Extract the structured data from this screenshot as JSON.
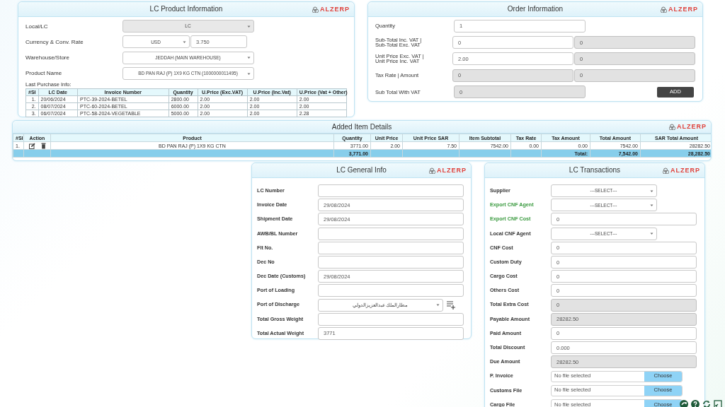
{
  "product_panel": {
    "title": "LC Product Information",
    "logo": "ALZERP",
    "fields": [
      {
        "label": "Local/LC",
        "controls": [
          {
            "kind": "select",
            "value": "LC",
            "disabled": true
          }
        ]
      },
      {
        "label": "Currency & Conv. Rate",
        "controls": [
          {
            "kind": "select",
            "value": "USD",
            "disabled": false
          },
          {
            "kind": "text",
            "value": "3.750",
            "readonly": false
          }
        ]
      },
      {
        "label": "Warehouse/Store",
        "controls": [
          {
            "kind": "select",
            "value": "JEDDAH (MAIN WAREHOUSE)",
            "disabled": false
          }
        ]
      },
      {
        "label": "Product Name",
        "controls": [
          {
            "kind": "select",
            "value": "BD PAN RAJ (P) 1X9 KG CTN (1000000011495)",
            "disabled": false
          }
        ]
      }
    ],
    "history_label": "Last Purchase Info:",
    "history": {
      "columns": [
        "#SI",
        "LC Date",
        "Invoice Number",
        "Quantity",
        "U.Price (Exc.VAT)",
        "U.Price (Inc.Vat)",
        "U.Price (Vat + Other)"
      ],
      "rows": [
        [
          "1.",
          "20/06/2024",
          "PTC-39-2024-BETEL",
          "2800.00",
          "2.00",
          "2.00",
          "2.00"
        ],
        [
          "2.",
          "08/07/2024",
          "PTC-60-2024-BETEL",
          "6000.00",
          "2.00",
          "2.00",
          "2.00"
        ],
        [
          "3.",
          "06/07/2024",
          "PTC-58-2024-VEGETABLE",
          "5000.00",
          "2.00",
          "2.00",
          "2.28"
        ]
      ]
    }
  },
  "order_panel": {
    "title": "Order Information",
    "logo": "ALZERP",
    "fields": [
      {
        "label": "Quantity",
        "controls": [
          {
            "kind": "text",
            "value": "1",
            "readonly": false
          }
        ]
      },
      {
        "label": "Sub-Total Inc. VAT |\nSub-Total Exc. VAT",
        "controls": [
          {
            "kind": "text",
            "value": "0",
            "readonly": false
          },
          {
            "kind": "text",
            "value": "0",
            "readonly": true
          }
        ]
      },
      {
        "label": "Unit Price Exc. VAT |\nUnit Price Inc. VAT",
        "controls": [
          {
            "kind": "text",
            "value": "2.00",
            "readonly": false
          },
          {
            "kind": "text",
            "value": "0",
            "readonly": true
          }
        ]
      },
      {
        "label": "Tax Rate | Amount",
        "controls": [
          {
            "kind": "text",
            "value": "0",
            "readonly": true
          },
          {
            "kind": "text",
            "value": "0",
            "readonly": true
          }
        ]
      },
      {
        "label": "Sub Total With VAT",
        "controls": [
          {
            "kind": "text",
            "value": "0",
            "readonly": true
          }
        ]
      }
    ],
    "button": "ADD"
  },
  "items_panel": {
    "title": "Added Item Details",
    "logo": "ALZERP",
    "columns": [
      "#SI",
      "Action",
      "Product",
      "Quantity",
      "Unit Price",
      "Unit Price SAR",
      "Item Subtotal",
      "Tax Rate",
      "Tax Amount",
      "Total Amount",
      "SAR Total Amount"
    ],
    "rows": [
      {
        "si": "1.",
        "product": "BD PAN RAJ (P) 1X9 KG CTN",
        "quantity": "3771.00",
        "unit_price": "2.00",
        "unit_price_sar": "7.50",
        "item_subtotal": "7542.00",
        "tax_rate": "0.00",
        "tax_amount": "0.00",
        "total_amount": "7542.00",
        "sar_total_amount": "28282.50"
      }
    ],
    "totals": {
      "quantity": "3,771.00",
      "label": "Total:",
      "total_amount": "7,542.00",
      "sar_total_amount": "28,282.50"
    }
  },
  "general_panel": {
    "title": "LC General Info",
    "logo": "ALZERP",
    "fields": [
      {
        "label": "LC Number",
        "controls": [
          {
            "kind": "text",
            "readonly": false
          }
        ]
      },
      {
        "label": "Invoice Date",
        "controls": [
          {
            "kind": "text",
            "value": "29/08/2024",
            "readonly": false
          }
        ]
      },
      {
        "label": "Shipment Date",
        "controls": [
          {
            "kind": "text",
            "value": "29/08/2024",
            "readonly": false
          }
        ]
      },
      {
        "label": "AWB/BL Number",
        "controls": [
          {
            "kind": "text",
            "readonly": false
          }
        ]
      },
      {
        "label": "Flt No.",
        "controls": [
          {
            "kind": "text",
            "readonly": false
          }
        ]
      },
      {
        "label": "Dec No",
        "controls": [
          {
            "kind": "text",
            "readonly": false
          }
        ]
      },
      {
        "label": "Dec Date (Customs)",
        "controls": [
          {
            "kind": "text",
            "value": "29/08/2024",
            "readonly": false
          }
        ]
      },
      {
        "label": "Port of Loading",
        "controls": [
          {
            "kind": "text",
            "readonly": false
          }
        ]
      },
      {
        "label": "Port of Discharge",
        "controls": [
          {
            "kind": "select",
            "value": "مطارالملك عبدالعزيزالدولي",
            "disabled": false
          },
          {
            "kind": "add"
          }
        ]
      },
      {
        "label": "Total Gross Weight",
        "controls": [
          {
            "kind": "text",
            "readonly": false
          }
        ]
      },
      {
        "label": "Total Actual Weight",
        "controls": [
          {
            "kind": "text",
            "value": "3771",
            "readonly": false
          }
        ]
      }
    ]
  },
  "transactions_panel": {
    "title": "LC Transactions",
    "logo": "ALZERP",
    "fields": [
      {
        "label": "Supplier",
        "color": "#333333",
        "controls": [
          {
            "kind": "select",
            "value": "---SELECT---",
            "disabled": false
          }
        ]
      },
      {
        "label": "Export CNF Agent",
        "color": "#3a9a3f",
        "controls": [
          {
            "kind": "select",
            "value": "---SELECT---",
            "disabled": false
          }
        ]
      },
      {
        "label": "Export CNF Cost",
        "color": "#3a9a3f",
        "controls": [
          {
            "kind": "text",
            "value": "0",
            "readonly": false
          }
        ]
      },
      {
        "label": "Local CNF Agent",
        "color": "#333333",
        "controls": [
          {
            "kind": "select",
            "value": "---SELECT---",
            "disabled": false
          }
        ]
      },
      {
        "label": "CNF Cost",
        "color": "#333333",
        "controls": [
          {
            "kind": "text",
            "value": "0",
            "readonly": false
          }
        ]
      },
      {
        "label": "Custom Duty",
        "color": "#333333",
        "controls": [
          {
            "kind": "text",
            "value": "0",
            "readonly": false
          }
        ]
      },
      {
        "label": "Cargo Cost",
        "color": "#333333",
        "controls": [
          {
            "kind": "text",
            "value": "0",
            "readonly": false
          }
        ]
      },
      {
        "label": "Others Cost",
        "color": "#333333",
        "controls": [
          {
            "kind": "text",
            "value": "0",
            "readonly": false
          }
        ]
      },
      {
        "label": "Total Extra Cost",
        "color": "#333333",
        "controls": [
          {
            "kind": "text",
            "value": "0",
            "readonly": true
          }
        ]
      },
      {
        "label": "Payable Amount",
        "color": "#333333",
        "controls": [
          {
            "kind": "text",
            "value": "28282.50",
            "readonly": true
          }
        ]
      },
      {
        "label": "Paid Amount",
        "color": "#333333",
        "controls": [
          {
            "kind": "text",
            "value": "0",
            "readonly": false
          }
        ]
      },
      {
        "label": "Total Discount",
        "color": "#333333",
        "controls": [
          {
            "kind": "text",
            "value": "0.000",
            "readonly": false
          }
        ]
      },
      {
        "label": "Due Amount",
        "color": "#333333",
        "controls": [
          {
            "kind": "text",
            "value": "28282.50",
            "readonly": true
          }
        ]
      },
      {
        "label": "P. Invoice",
        "color": "#333333",
        "controls": [
          {
            "kind": "file",
            "value": "No file selected",
            "button": "Choose"
          }
        ]
      },
      {
        "label": "Customs File",
        "color": "#333333",
        "controls": [
          {
            "kind": "file",
            "value": "No file selected",
            "button": "Choose"
          }
        ]
      },
      {
        "label": "Cargo File",
        "color": "#333333",
        "controls": [
          {
            "kind": "file",
            "value": "No file selected",
            "button": "Choose"
          }
        ]
      }
    ]
  }
}
